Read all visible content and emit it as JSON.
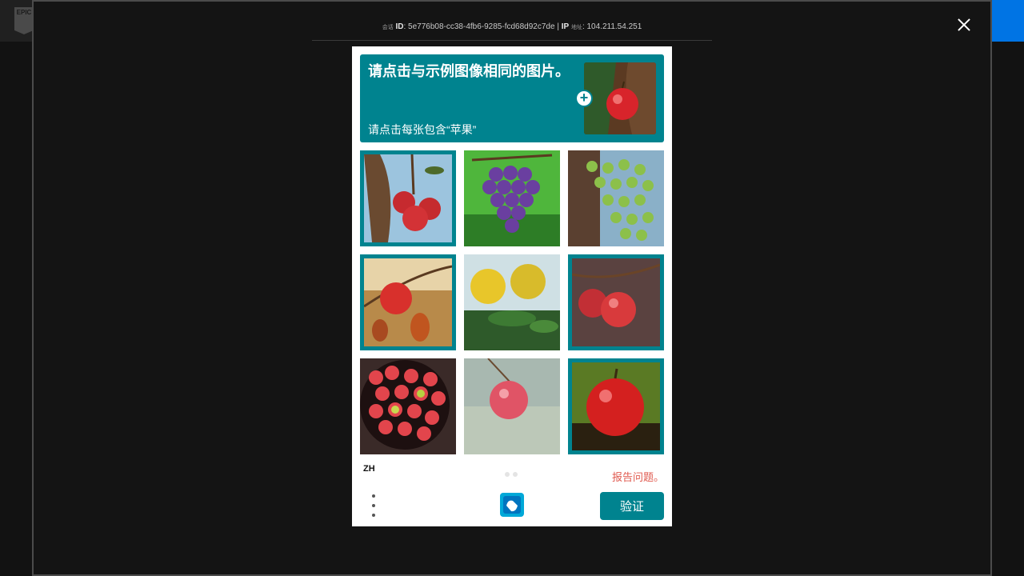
{
  "header": {
    "logo_text": "EPIC"
  },
  "session": {
    "id_prefix": "会话",
    "id_label": "ID",
    "id_value": "5e776b08-cc38-4fb6-9285-fcd68d92c7de",
    "separator": "|",
    "ip_label": "IP",
    "ip_prefix": "地址",
    "ip_value": "104.211.54.251"
  },
  "captcha": {
    "title": "请点击与示例图像相同的图片。",
    "subtitle": "请点击每张包含“苹果”",
    "language": "ZH",
    "report_label": "报告问题。",
    "verify_label": "验证",
    "tiles": [
      {
        "subject": "apples on branch",
        "selected": true
      },
      {
        "subject": "purple grapes",
        "selected": false
      },
      {
        "subject": "green grapes",
        "selected": false
      },
      {
        "subject": "apple with leaves",
        "selected": true
      },
      {
        "subject": "lemons",
        "selected": false
      },
      {
        "subject": "two apples",
        "selected": true
      },
      {
        "subject": "bowl of apples",
        "selected": false
      },
      {
        "subject": "hanging apple",
        "selected": false
      },
      {
        "subject": "single apple",
        "selected": true
      }
    ]
  },
  "colors": {
    "accent": "#00838f",
    "report": "#e05a4f",
    "epic_blue": "#0074e4"
  }
}
